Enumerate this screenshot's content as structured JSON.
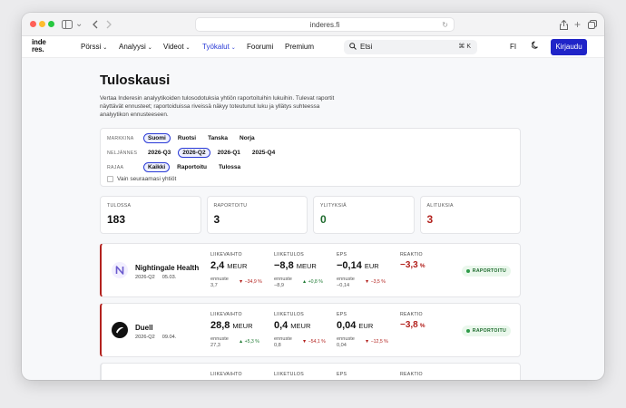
{
  "browser": {
    "url": "inderes.fi",
    "icons": [
      "sidebar-icon",
      "back-icon",
      "forward-icon",
      "reload-icon",
      "share-icon",
      "new-tab-icon",
      "tabs-icon"
    ]
  },
  "nav": {
    "logo_line1": "inde",
    "logo_line2": "res.",
    "items": [
      {
        "label": "Pörssi",
        "chevron": "⌄"
      },
      {
        "label": "Analyysi",
        "chevron": "⌄"
      },
      {
        "label": "Videot",
        "chevron": "⌄"
      },
      {
        "label": "Työkalut",
        "chevron": "⌄"
      },
      {
        "label": "Foorumi"
      },
      {
        "label": "Premium"
      }
    ],
    "search_placeholder": "Etsi",
    "search_shortcut": "⌘ K",
    "lang": "FI",
    "login": "Kirjaudu",
    "accent": "#2024c8"
  },
  "page": {
    "title": "Tuloskausi",
    "intro": "Vertaa Inderesin analyytikoiden tulosodotuksia yhtiön raportoituihin lukuihin. Tulevat raportit näyttävät ennusteet; raportoiduissa riveissä näkyy toteutunut luku ja yllätys suhteessa analyytikon ennusteeseen."
  },
  "filters": {
    "market": {
      "label": "MARKKINA",
      "options": [
        "Suomi",
        "Ruotsi",
        "Tanska",
        "Norja"
      ],
      "selected": 0
    },
    "quarter": {
      "label": "NELJÄNNES",
      "options": [
        "2026-Q3",
        "2026-Q2",
        "2026-Q1",
        "2025-Q4"
      ],
      "selected": 1
    },
    "limit": {
      "label": "RAJAA",
      "options": [
        "Kaikki",
        "Raportoitu",
        "Tulossa"
      ],
      "selected": 0
    },
    "followed_only": "Vain seuraamasi yhtiöt"
  },
  "stats": [
    {
      "label": "TULOSSA",
      "value": "183",
      "color": "#111111"
    },
    {
      "label": "RAPORTOITU",
      "value": "3",
      "color": "#111111"
    },
    {
      "label": "YLITYKSIÄ",
      "value": "0",
      "color": "#1f6b2e"
    },
    {
      "label": "ALITUKSIA",
      "value": "3",
      "color": "#b3221e"
    }
  ],
  "metric_labels": {
    "revenue": "LIIKEVAIHTO",
    "ebit": "LIIKETULOS",
    "eps": "EPS",
    "reaction": "REAKTIO",
    "forecast": "ennuste"
  },
  "companies": [
    {
      "name": "Nightingale Health",
      "quarter": "2026-Q2",
      "date": "05.03.",
      "logo": "N",
      "revenue": {
        "value": "2,4",
        "unit": "MEUR",
        "forecast": "3,7",
        "delta": "▼ −34,9 %",
        "dir": "down"
      },
      "ebit": {
        "value": "−8,8",
        "unit": "MEUR",
        "forecast": "−8,9",
        "delta": "▲ +0,8 %",
        "dir": "up"
      },
      "eps": {
        "value": "−0,14",
        "unit": "EUR",
        "forecast": "−0,14",
        "delta": "▼ −3,5 %",
        "dir": "down"
      },
      "reaction": {
        "value": "−3,3",
        "unit": "%"
      },
      "status": "RAPORTOITU"
    },
    {
      "name": "Duell",
      "quarter": "2026-Q2",
      "date": "09.04.",
      "logo": "D",
      "revenue": {
        "value": "28,8",
        "unit": "MEUR",
        "forecast": "27,3",
        "delta": "▲ +5,3 %",
        "dir": "up"
      },
      "ebit": {
        "value": "0,4",
        "unit": "MEUR",
        "forecast": "0,8",
        "delta": "▼ −54,1 %",
        "dir": "down"
      },
      "eps": {
        "value": "0,04",
        "unit": "EUR",
        "forecast": "0,04",
        "delta": "▼ −12,5 %",
        "dir": "down"
      },
      "reaction": {
        "value": "−3,8",
        "unit": "%"
      },
      "status": "RAPORTOITU"
    },
    {
      "name": "",
      "quarter": "",
      "date": "",
      "logo": "",
      "revenue": {
        "value": "",
        "unit": "",
        "forecast": "",
        "delta": "",
        "dir": ""
      },
      "ebit": {
        "value": "",
        "unit": "",
        "forecast": "",
        "delta": "",
        "dir": ""
      },
      "eps": {
        "value": "",
        "unit": "",
        "forecast": "",
        "delta": "",
        "dir": ""
      },
      "reaction": {
        "value": "",
        "unit": ""
      },
      "status": ""
    }
  ]
}
